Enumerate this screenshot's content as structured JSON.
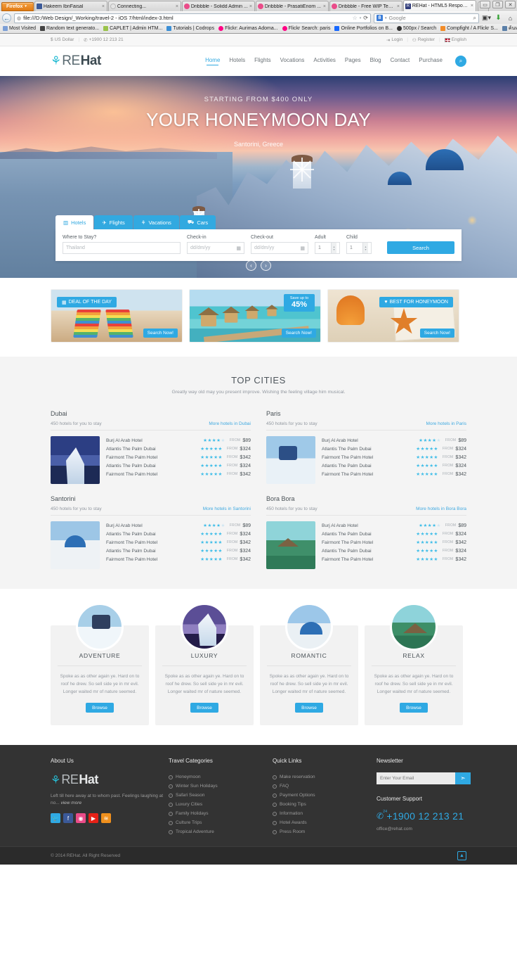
{
  "browser": {
    "firefox_button": "Firefox",
    "firefox_caret": "▾",
    "tabs": [
      {
        "title": "Hakeem IbnFaisal",
        "favicon": "facebook-icon",
        "color": "#3b5998",
        "glyph": "f",
        "active": false
      },
      {
        "title": "Connecting...",
        "favicon": "loading-icon",
        "color": "#dddddd",
        "glyph": "◌",
        "active": false
      },
      {
        "title": "Dribbble - Solidd Admin ...",
        "favicon": "dribbble-icon",
        "color": "#ea4c89",
        "glyph": "●",
        "active": false
      },
      {
        "title": "Dribbble - PrasatiEnom ...",
        "favicon": "dribbble-icon",
        "color": "#ea4c89",
        "glyph": "●",
        "active": false
      },
      {
        "title": "Dribbble - Free WIP Tem...",
        "favicon": "dribbble-icon",
        "color": "#ea4c89",
        "glyph": "●",
        "active": false
      },
      {
        "title": "REHat - HTML5 Responsi...",
        "favicon": "rehat-icon",
        "color": "#2f3b7a",
        "glyph": "R",
        "active": true
      }
    ],
    "new_tab_label": "+",
    "close_tab_glyph": "×",
    "window_buttons": [
      "▭",
      "❐",
      "✕"
    ],
    "back_glyph": "←",
    "url": "file:///D:/Web Design/_Working/travel-2 - iOS 7/html/index-3.html",
    "url_globe": "◍",
    "bookmark_star": "☆",
    "reload_glyph": "⟳",
    "search_engine": "Google",
    "search_engine_glyph": "8",
    "search_placeholder": "Google",
    "magnifier_glyph": "⌕",
    "toolbar_icons": [
      "📰",
      "⬇",
      "🏠"
    ],
    "bookmarks": [
      {
        "label": "Most Visited",
        "color": "#7b9fd6",
        "glyph": "▣"
      },
      {
        "label": "Random text generato...",
        "color": "#444444",
        "glyph": "R"
      },
      {
        "label": "CAPLET | Admin HTM...",
        "color": "#9ac34b",
        "glyph": "✦"
      },
      {
        "label": "Tutorials | Codrops",
        "color": "#3b8fd6",
        "glyph": "▐"
      },
      {
        "label": "Flickr: Aurimas Adoma...",
        "color": "#ff0084",
        "glyph": "●●"
      },
      {
        "label": "Flickr Search: paris",
        "color": "#ff0084",
        "glyph": "●●"
      },
      {
        "label": "Online Portfolios on B...",
        "color": "#1769ff",
        "glyph": "Bē"
      },
      {
        "label": "500px / Search",
        "color": "#333333",
        "glyph": "∞"
      },
      {
        "label": "Compfight / A Flickr S...",
        "color": "#f28c28",
        "glyph": "C"
      },
      {
        "label": "ค้นหารูปภาพ",
        "color": "#5a7fa8",
        "glyph": "▤"
      }
    ]
  },
  "topbar": {
    "currency": "US Dollar",
    "currency_icon": "dollar-icon",
    "phone": "+1900 12 213 21",
    "phone_icon": "phone-icon",
    "login": "Login",
    "login_icon": "login-icon",
    "register": "Register",
    "register_icon": "user-add-icon",
    "language": "English",
    "language_icon": "uk-flag-icon"
  },
  "header": {
    "logo": {
      "palm": "⚘",
      "re": "RE",
      "hat": "Hat"
    },
    "nav": [
      {
        "label": "Home",
        "active": true
      },
      {
        "label": "Hotels",
        "active": false
      },
      {
        "label": "Flights",
        "active": false
      },
      {
        "label": "Vocations",
        "active": false
      },
      {
        "label": "Activities",
        "active": false
      },
      {
        "label": "Pages",
        "active": false
      },
      {
        "label": "Blog",
        "active": false
      },
      {
        "label": "Contact",
        "active": false
      },
      {
        "label": "Purchase",
        "active": false
      }
    ],
    "search_icon": "search-icon"
  },
  "hero": {
    "kicker": "STARTING FROM $400 ONLY",
    "title": "YOUR HONEYMOON DAY",
    "subtitle": "Santorini, Greece",
    "prev_glyph": "‹",
    "next_glyph": "›"
  },
  "search_widget": {
    "tabs": [
      {
        "label": "Hotels",
        "icon": "building-icon",
        "glyph": "▥",
        "active": true
      },
      {
        "label": "Flights",
        "icon": "plane-icon",
        "glyph": "✈",
        "active": false
      },
      {
        "label": "Vacations",
        "icon": "palm-icon",
        "glyph": "⚘",
        "active": false
      },
      {
        "label": "Cars",
        "icon": "car-icon",
        "glyph": "⛟",
        "active": false
      }
    ],
    "fields": {
      "stay_label": "Where to Stay?",
      "stay_placeholder": "Thailand",
      "checkin_label": "Check-in",
      "checkin_placeholder": "dd/dm/yy",
      "checkout_label": "Check-out",
      "checkout_placeholder": "dd/dm/yy",
      "adult_label": "Adult",
      "adult_value": "1",
      "child_label": "Child",
      "child_value": "1",
      "calendar_icon": "calendar-icon"
    },
    "search_button": "Search"
  },
  "deals": [
    {
      "badge": "DEAL OF THE DAY",
      "badge_icon": "calendar-icon",
      "badge_glyph": "▦",
      "badge_side": "left",
      "cta": "Search Now!"
    },
    {
      "save_line1": "Save up to",
      "save_line2": "45%",
      "cta": "Search Now!"
    },
    {
      "badge": "BEST FOR HONEYMOON",
      "badge_icon": "heart-icon",
      "badge_glyph": "♥",
      "badge_side": "right",
      "cta": "Search Now!"
    }
  ],
  "top_cities": {
    "title": "TOP CITIES",
    "lead": "Greatly way old may you present improve. Wishing the feeling village him musical.",
    "from_label": "FROM",
    "cities": [
      {
        "name": "Dubai",
        "count": "450 hotels for you to stay",
        "more": "More hotels in Dubai",
        "thumb": "burj-al-arab-thumb",
        "hotels": [
          {
            "name": "Burj Al Arab Hotel",
            "stars": 4,
            "price": "$89"
          },
          {
            "name": "Atlantis The Palm Dubai",
            "stars": 5,
            "price": "$324"
          },
          {
            "name": "Fairmont The Palm Hotel",
            "stars": 5,
            "price": "$342"
          },
          {
            "name": "Atlantis The Palm Dubai",
            "stars": 5,
            "price": "$324"
          },
          {
            "name": "Fairmont The Palm Hotel",
            "stars": 5,
            "price": "$342"
          }
        ]
      },
      {
        "name": "Paris",
        "count": "450 hotels for you to stay",
        "more": "More hotels in Paris",
        "thumb": "gondola-thumb",
        "hotels": [
          {
            "name": "Burj Al Arab Hotel",
            "stars": 4,
            "price": "$89"
          },
          {
            "name": "Atlantis The Palm Dubai",
            "stars": 5,
            "price": "$324"
          },
          {
            "name": "Fairmont The Palm Hotel",
            "stars": 5,
            "price": "$342"
          },
          {
            "name": "Atlantis The Palm Dubai",
            "stars": 5,
            "price": "$324"
          },
          {
            "name": "Fairmont The Palm Hotel",
            "stars": 5,
            "price": "$342"
          }
        ]
      },
      {
        "name": "Santorini",
        "count": "450 hotels for you to stay",
        "more": "More hotels in Santorini",
        "thumb": "santorini-thumb",
        "hotels": [
          {
            "name": "Burj Al Arab Hotel",
            "stars": 4,
            "price": "$89"
          },
          {
            "name": "Atlantis The Palm Dubai",
            "stars": 5,
            "price": "$324"
          },
          {
            "name": "Fairmont The Palm Hotel",
            "stars": 5,
            "price": "$342"
          },
          {
            "name": "Atlantis The Palm Dubai",
            "stars": 5,
            "price": "$324"
          },
          {
            "name": "Fairmont The Palm Hotel",
            "stars": 5,
            "price": "$342"
          }
        ]
      },
      {
        "name": "Bora Bora",
        "count": "450 hotels for you to stay",
        "more": "More hotels in Bora Bora",
        "thumb": "bora-bora-thumb",
        "hotels": [
          {
            "name": "Burj Al Arab Hotel",
            "stars": 4,
            "price": "$89"
          },
          {
            "name": "Atlantis The Palm Dubai",
            "stars": 5,
            "price": "$324"
          },
          {
            "name": "Fairmont The Palm Hotel",
            "stars": 5,
            "price": "$342"
          },
          {
            "name": "Atlantis The Palm Dubai",
            "stars": 5,
            "price": "$324"
          },
          {
            "name": "Fairmont The Palm Hotel",
            "stars": 5,
            "price": "$342"
          }
        ]
      }
    ]
  },
  "features": [
    {
      "title": "ADVENTURE",
      "text": "Spoke as as other again ye. Hard on to roof he drew. So sell side ye in mr evil. Longer waited mr of nature seemed.",
      "button": "Browse",
      "image": "adventure-gondola-circle"
    },
    {
      "title": "LUXURY",
      "text": "Spoke as as other again ye. Hard on to roof he drew. So sell side ye in mr evil. Longer waited mr of nature seemed.",
      "button": "Browse",
      "image": "luxury-burj-circle"
    },
    {
      "title": "ROMANTIC",
      "text": "Spoke as as other again ye. Hard on to roof he drew. So sell side ye in mr evil. Longer waited mr of nature seemed.",
      "button": "Browse",
      "image": "romantic-santorini-circle"
    },
    {
      "title": "RELAX",
      "text": "Spoke as as other again ye. Hard on to roof he drew. So sell side ye in mr evil. Longer waited mr of nature seemed.",
      "button": "Browse",
      "image": "relax-bungalow-circle"
    }
  ],
  "footer": {
    "about": {
      "heading": "About Us",
      "logo": {
        "palm": "⚘",
        "re": "RE",
        "hat": "Hat"
      },
      "text": "Left till here away at to whom past. Feelings laughing at no...",
      "view_more": "view more",
      "social": [
        {
          "name": "twitter-icon",
          "glyph": "t",
          "color": "#2fa9e3"
        },
        {
          "name": "facebook-icon",
          "glyph": "f",
          "color": "#3b5998"
        },
        {
          "name": "dribbble-icon",
          "glyph": "◉",
          "color": "#ea4c89"
        },
        {
          "name": "youtube-icon",
          "glyph": "▶",
          "color": "#e62117"
        },
        {
          "name": "rss-icon",
          "glyph": "≋",
          "color": "#f0901d"
        }
      ]
    },
    "categories": {
      "heading": "Travel Categories",
      "items": [
        "Honeymoon",
        "Winter Sun Holidays",
        "Safari Season",
        "Luxury Cities",
        "Family Holidays",
        "Culture Trips",
        "Tropical Adventure"
      ]
    },
    "quicklinks": {
      "heading": "Quick Links",
      "items": [
        "Make reservation",
        "FAQ",
        "Payment Options",
        "Booking Tips",
        "Information",
        "Hotel Awards",
        "Press Room"
      ]
    },
    "newsletter": {
      "heading": "Newsletter",
      "placeholder": "Enter Your Email",
      "submit_icon": "arrow-circle-icon",
      "submit_glyph": "➤"
    },
    "support": {
      "heading": "Customer Support",
      "phone_icon": "phone-24-icon",
      "phone_badge": "24",
      "phone": "+1900 12 213 21",
      "email": "office@rehat.com"
    },
    "copyright": "© 2014 REHat. All Right Reserved",
    "to_top_glyph": "▲"
  },
  "colors": {
    "accent": "#2fa9e3",
    "star": "#3fbde8",
    "footer_bg": "#333333",
    "section_bg": "#f4f4f4"
  }
}
